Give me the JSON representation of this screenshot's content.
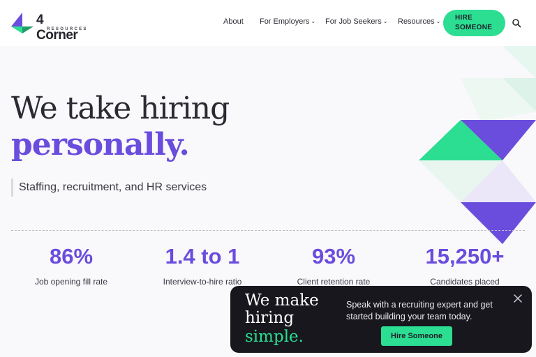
{
  "brand": {
    "name": "4 Corner",
    "subtitle": "RESOURCES"
  },
  "nav": {
    "about": "About",
    "employers": "For Employers",
    "job_seekers": "For Job Seekers",
    "resources": "Resources",
    "chevron": "⌄",
    "hire_line1": "HIRE",
    "hire_line2": "SOMEONE"
  },
  "hero": {
    "line1": "We take hiring",
    "line2": "personally.",
    "subhead": "Staffing, recruitment, and HR services"
  },
  "stats": [
    {
      "value": "86%",
      "label": "Job opening fill rate"
    },
    {
      "value": "1.4 to 1",
      "label": "Interview-to-hire ratio"
    },
    {
      "value": "93%",
      "label": "Client retention rate"
    },
    {
      "value": "15,250+",
      "label": "Candidates placed"
    }
  ],
  "popup": {
    "line1": "We make",
    "line2": "hiring",
    "line3": "simple.",
    "message": "Speak with a recruiting expert and get started building your team today.",
    "button": "Hire Someone"
  },
  "colors": {
    "purple": "#6a4ddd",
    "green": "#2bde92",
    "dark": "#17171d"
  }
}
